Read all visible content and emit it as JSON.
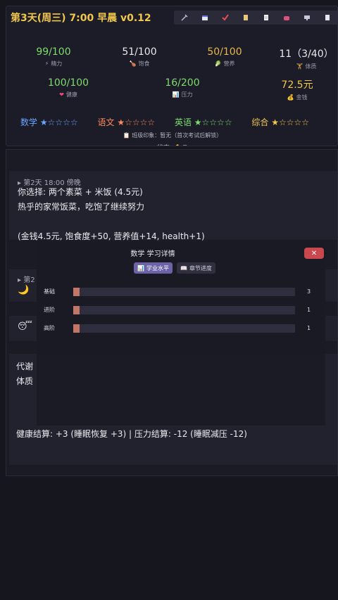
{
  "header": {
    "title": "第3天(周三)  7:00  早晨  v0.12"
  },
  "toolbar": [
    {
      "icon": "syringe-icon",
      "glyph": "💉"
    },
    {
      "icon": "calendar-icon",
      "glyph": "📅"
    },
    {
      "icon": "check-icon",
      "glyph": "✔"
    },
    {
      "icon": "scroll-icon",
      "glyph": "📜"
    },
    {
      "icon": "document-icon",
      "glyph": "📄"
    },
    {
      "icon": "bag-icon",
      "glyph": "👛"
    },
    {
      "icon": "monitor-icon",
      "glyph": "🖥"
    },
    {
      "icon": "save-icon",
      "glyph": "💾"
    }
  ],
  "stats": {
    "energy": {
      "value": "99/100",
      "label": "精力",
      "icon": "⚡"
    },
    "satiety": {
      "value": "51/100",
      "label": "饱食",
      "icon": "🍗"
    },
    "nutrition": {
      "value": "50/100",
      "label": "营养",
      "icon": "🥬"
    },
    "physique": {
      "value": "11（3/40）",
      "label": "体质",
      "icon": "🏋"
    },
    "health": {
      "value": "100/100",
      "label": "健康",
      "icon": "❤"
    },
    "stress": {
      "value": "16/200",
      "label": "压力",
      "icon": "📊"
    },
    "money": {
      "value": "72.5元",
      "label": "金钱",
      "icon": "💰"
    }
  },
  "subjects": [
    {
      "name": "数学",
      "stars": "★☆☆☆☆",
      "color": "#6aa6ff"
    },
    {
      "name": "语文",
      "stars": "★☆☆☆☆",
      "color": "#ff8a5a"
    },
    {
      "name": "英语",
      "stars": "★☆☆☆☆",
      "color": "#7ddc6c"
    },
    {
      "name": "综合",
      "stars": "★☆☆☆☆",
      "color": "#f2c84b"
    }
  ],
  "impression": "📋 班级印象：暂无（首次考试后解锁）",
  "state": "状态: 💪😊",
  "log": {
    "entry1_head": "▸ 第2天 18:00 傍晚",
    "entry1_lines": [
      "你选择: 两个素菜 + 米饭 (4.5元)",
      "热乎的家常饭菜，吃饱了继续努力",
      "",
      "(金钱4.5元, 饱食度+50, 营养值+14, health+1)"
    ],
    "entry2_head": "▸ 第2",
    "entry2_icon": "🌙",
    "entry3_icon": "😴",
    "line_metabolism": "代谢",
    "line_physique": "体质",
    "line_health": "健康结算: +3 (睡眠恢复 +3) | 压力结算: -12 (睡眠减压 -12)"
  },
  "modal": {
    "title": "数学 学习详情",
    "close": "✕",
    "tabs": [
      {
        "label": "学业水平",
        "icon": "📊",
        "active": true
      },
      {
        "label": "章节进度",
        "icon": "📖",
        "active": false
      }
    ],
    "levels": [
      {
        "label": "基础",
        "value": 3,
        "max": 100
      },
      {
        "label": "进阶",
        "value": 1,
        "max": 100
      },
      {
        "label": "高阶",
        "value": 1,
        "max": 100
      }
    ]
  },
  "colors": {
    "accent": "#f2c84b",
    "energy": "#7ddc6c",
    "nutrition": "#e8b64c",
    "modal_close": "#c9484d",
    "tab_active": "#6b62a8"
  }
}
